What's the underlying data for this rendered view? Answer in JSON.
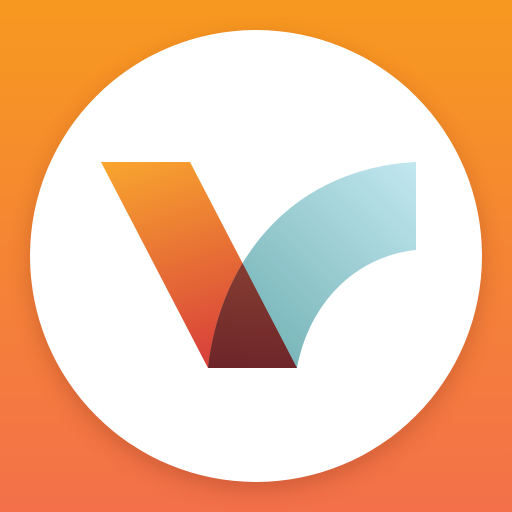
{
  "icon": {
    "name": "checkmark-v-logo-icon",
    "colors": {
      "background_top": "#F7991F",
      "background_bottom": "#F3704A",
      "badge": "#FFFFFF",
      "left_stroke_top": "#F9A62E",
      "left_stroke_bottom": "#D9443A",
      "right_stroke_top": "#BFE6EF",
      "right_stroke_bottom": "#5FA6A8",
      "overlap_top": "#9A4A2E",
      "overlap_bottom": "#6E1A1E"
    }
  }
}
